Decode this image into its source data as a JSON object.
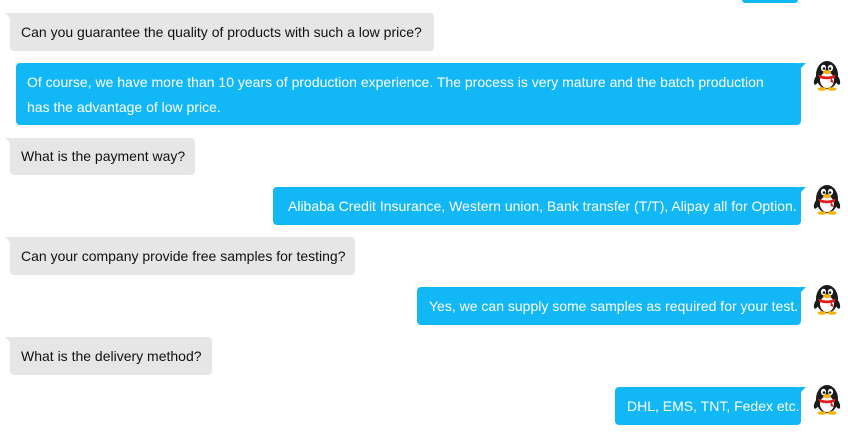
{
  "colors": {
    "incoming_bubble": "#e6e6e6",
    "outgoing_bubble": "#12b7f5",
    "outgoing_text": "#ffffff"
  },
  "chat": {
    "messages": [
      {
        "side": "in",
        "text": "Can you guarantee the quality of products with such a low price?"
      },
      {
        "side": "out",
        "text": "Of course, we have more than 10 years of production experience. The process is very mature and the batch production has the advantage of low price.",
        "avatar_icon": "qq-penguin-icon"
      },
      {
        "side": "in",
        "text": "What is the payment way?"
      },
      {
        "side": "out",
        "text": "Alibaba Credit Insurance, Western union, Bank transfer (T/T), Alipay all for Option.",
        "avatar_icon": "qq-penguin-icon"
      },
      {
        "side": "in",
        "text": "Can your company provide free samples for testing?"
      },
      {
        "side": "out",
        "text": "Yes, we can supply some samples as required for your test.",
        "avatar_icon": "qq-penguin-icon"
      },
      {
        "side": "in",
        "text": "What is the delivery method?"
      },
      {
        "side": "out",
        "text": "DHL, EMS, TNT, Fedex etc.",
        "avatar_icon": "qq-penguin-icon"
      }
    ]
  }
}
